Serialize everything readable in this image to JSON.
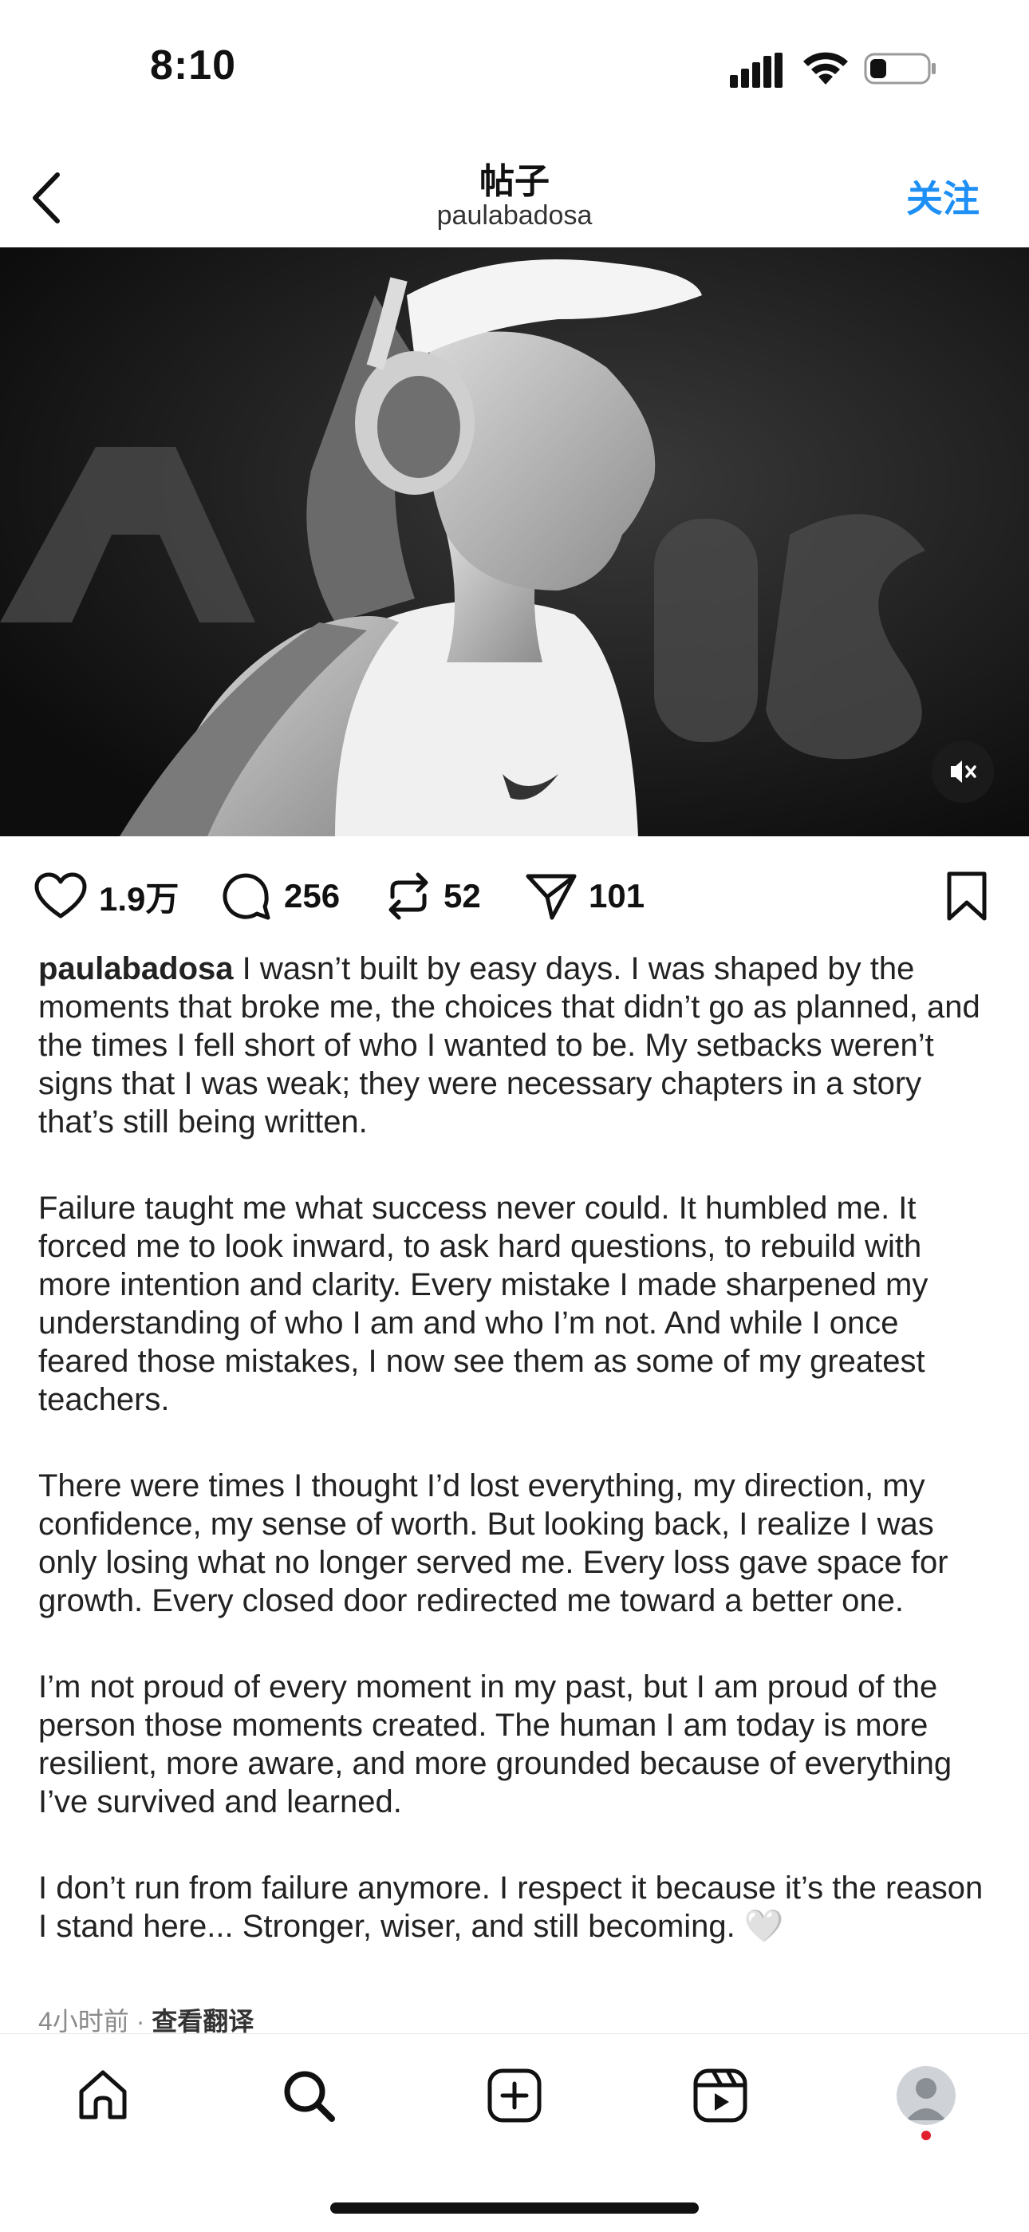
{
  "status_bar": {
    "time": "8:10"
  },
  "header": {
    "title": "帖子",
    "username": "paulabadosa",
    "follow_label": "关注"
  },
  "post": {
    "likes": "1.9万",
    "comments": "256",
    "reposts": "52",
    "shares": "101",
    "author": "paulabadosa",
    "paragraphs": [
      "I wasn’t built by easy days. I was shaped by the moments that broke me, the choices that didn’t go as planned, and the times I fell short of who I wanted to be. My setbacks weren’t signs that I was weak; they were necessary chapters in a story that’s still being written.",
      "Failure taught me what success never could. It humbled me. It forced me to look inward, to ask hard questions, to rebuild with more intention and clarity. Every mistake I made sharpened my understanding of who I am and who I’m not. And while I once feared those mistakes, I now see them as some of my greatest teachers.",
      "There were times I thought I’d lost everything, my direction, my confidence, my sense of worth. But looking back, I realize I was only losing what no longer served me. Every loss gave space for growth. Every closed door redirected me toward a better one.",
      "I’m not proud of every moment in my past, but I am proud of the person those moments created. The human I am today is more resilient, more aware, and more grounded because of everything I’ve survived and learned.",
      "I don’t run from failure anymore. I respect it because it’s the reason I stand here... Stronger, wiser, and still becoming. 🤍"
    ],
    "time_ago": "4小时前",
    "separator": "·",
    "translate_label": "查看翻译"
  },
  "icons": {
    "back": "chevron-left-icon",
    "like": "heart-icon",
    "comment": "comment-icon",
    "repost": "repost-icon",
    "share": "send-icon",
    "save": "bookmark-icon",
    "mute": "speaker-muted-icon",
    "tabs": [
      "home-icon",
      "search-icon",
      "create-icon",
      "reels-icon",
      "profile-avatar"
    ]
  },
  "colors": {
    "accent": "#1e8ff5",
    "notification": "#e0202e"
  }
}
